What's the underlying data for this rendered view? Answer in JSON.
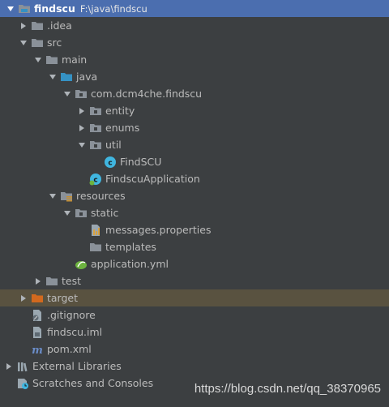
{
  "tree": {
    "root": {
      "name": "findscu",
      "path": "F:\\java\\findscu"
    },
    "idea": ".idea",
    "src": "src",
    "main": "main",
    "java": "java",
    "package": "com.dcm4che.findscu",
    "entity": "entity",
    "enums": "enums",
    "util": "util",
    "findscu_class": "FindSCU",
    "app_class": "FindscuApplication",
    "resources": "resources",
    "static": "static",
    "messages": "messages.properties",
    "templates": "templates",
    "app_yml": "application.yml",
    "test": "test",
    "target": "target",
    "gitignore": ".gitignore",
    "iml": "findscu.iml",
    "pom": "pom.xml",
    "external_libraries": "External Libraries",
    "scratches": "Scratches and Consoles"
  },
  "watermark": "https://blog.csdn.net/qq_38370965",
  "colors": {
    "background": "#3c3f41",
    "selection": "#4b6eaf",
    "excluded_folder_row": "#595240",
    "folder": "#8a9199",
    "source_folder": "#3592c4",
    "resources_folder": "#c78f2f",
    "excluded_folder": "#d2691e",
    "class_icon": "#40b6e0"
  }
}
